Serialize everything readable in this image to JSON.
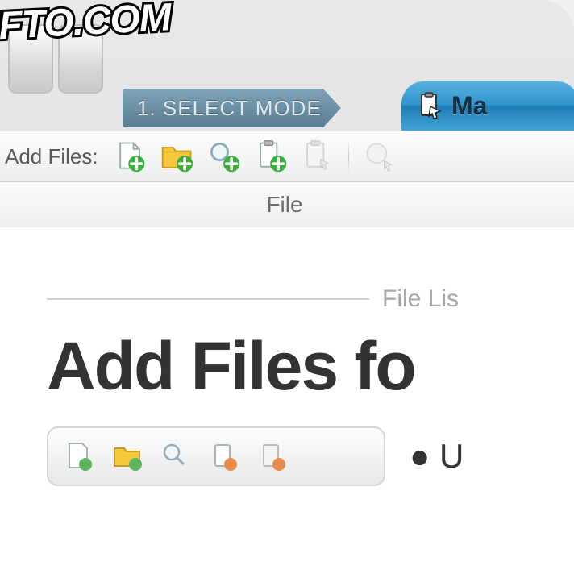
{
  "watermark": "IFTO.COM",
  "steps": {
    "step1_label": "1. SELECT MODE",
    "active_tab_label": "Ma"
  },
  "toolbar": {
    "label": "Add Files:"
  },
  "columns": {
    "file": "File"
  },
  "main": {
    "divider_label": "File Lis",
    "big_title": "Add Files fo",
    "bullet1": "● U"
  }
}
